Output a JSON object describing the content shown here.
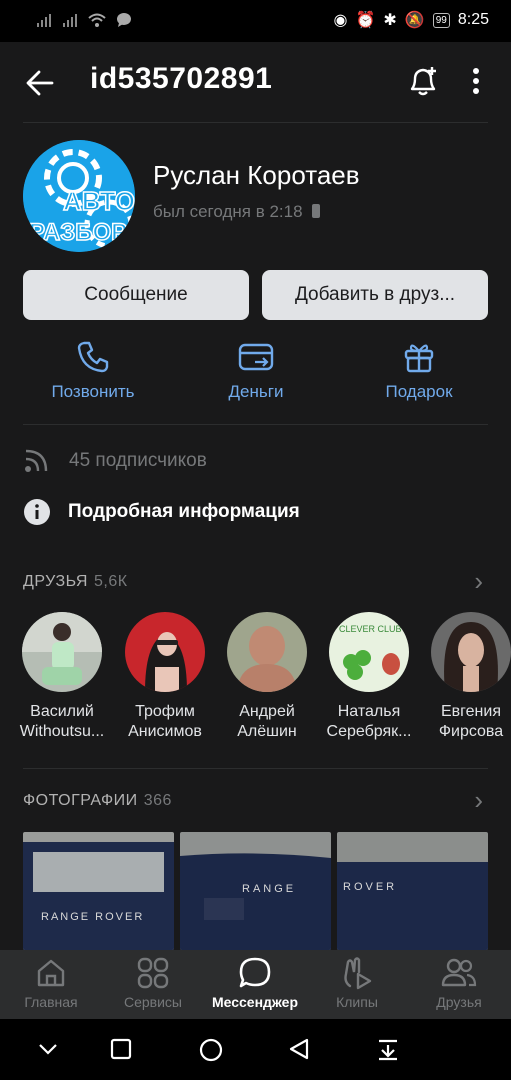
{
  "status_bar": {
    "time": "8:25",
    "battery": "99"
  },
  "header": {
    "title": "id535702891"
  },
  "profile": {
    "name": "Руслан Коротаев",
    "last_seen": "был сегодня в 2:18",
    "avatar_text_top": "АВТО",
    "avatar_text_bottom": "РАЗБОР"
  },
  "buttons": {
    "message": "Сообщение",
    "add_friend": "Добавить в друз..."
  },
  "actions": {
    "call": "Позвонить",
    "money": "Деньги",
    "gift": "Подарок"
  },
  "info": {
    "followers": "45 подписчиков",
    "details": "Подробная информация"
  },
  "friends": {
    "title": "ДРУЗЬЯ",
    "count": "5,6К",
    "items": [
      {
        "line1": "Василий",
        "line2": "Withoutsu..."
      },
      {
        "line1": "Трофим",
        "line2": "Анисимов"
      },
      {
        "line1": "Андрей",
        "line2": "Алёшин"
      },
      {
        "line1": "Наталья",
        "line2": "Серебряк..."
      },
      {
        "line1": "Евгения",
        "line2": "Фирсова"
      }
    ],
    "clever_club": "CLEVER CLUB"
  },
  "photos": {
    "title": "ФОТОГРАФИИ",
    "count": "366",
    "captions": [
      "RANGE ROVER",
      "RANGE",
      "ROVER"
    ]
  },
  "bottom_nav": {
    "home": "Главная",
    "services": "Сервисы",
    "messenger": "Мессенджер",
    "clips": "Клипы",
    "friends": "Друзья"
  },
  "colors": {
    "accent": "#71aaeb",
    "background": "#19191a",
    "avatar_bg": "#1aa3e8"
  }
}
